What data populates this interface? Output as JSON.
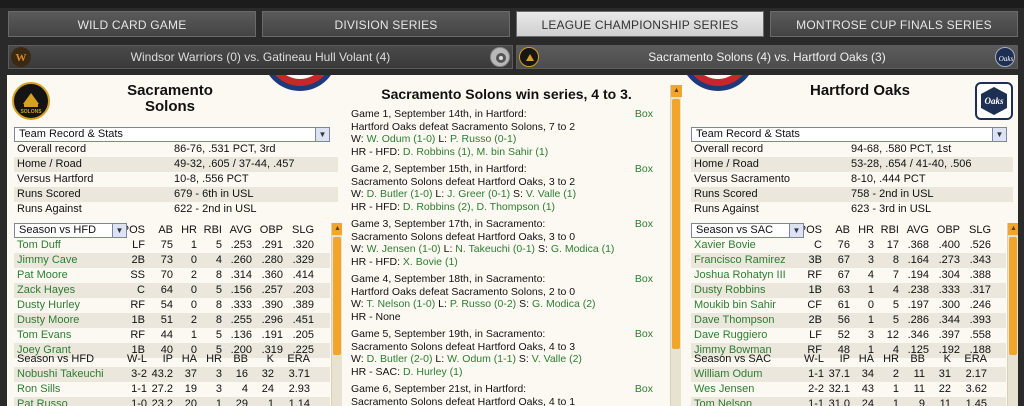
{
  "tabs": [
    {
      "label": "WILD CARD GAME",
      "active": false
    },
    {
      "label": "DIVISION SERIES",
      "active": false
    },
    {
      "label": "LEAGUE CHAMPIONSHIP SERIES",
      "active": true
    },
    {
      "label": "MONTROSE CUP FINALS SERIES",
      "active": false
    }
  ],
  "series": [
    {
      "label": "Windsor Warriors (0) vs. Gatineau Hull Volant  (4)",
      "active": false,
      "left_logo": "warriors-logo-icon",
      "right_logo": "volant-logo-icon"
    },
    {
      "label": "Sacramento Solons (4) vs. Hartford Oaks (3)",
      "active": true,
      "left_logo": "solons-logo-icon",
      "right_logo": "oaks-logo-icon"
    }
  ],
  "colors": {
    "accent_green": "#2e7d32",
    "scroll_orange": "#f1a52b",
    "active_tab": "#e0e0e0"
  },
  "left": {
    "team_name": "Sacramento Solons",
    "logo_text": "SOLONS",
    "dropdown": "Team Record & Stats",
    "stats": [
      {
        "label": "Overall record",
        "value": "86-76, .531 PCT, 3rd"
      },
      {
        "label": "Home / Road",
        "value": "49-32, .605 / 37-44, .457"
      },
      {
        "label": "Versus Hartford",
        "value": "10-8, .556 PCT"
      },
      {
        "label": "Runs Scored",
        "value": "679 - 6th  in USL"
      },
      {
        "label": "Runs Against",
        "value": "622 - 2nd  in USL"
      }
    ],
    "batting_dropdown": "Season vs HFD",
    "batting_headers": [
      "POS",
      "AB",
      "HR",
      "RBI",
      "AVG",
      "OBP",
      "SLG"
    ],
    "batters": [
      {
        "name": "Tom Duff",
        "pos": "LF",
        "ab": "75",
        "hr": "1",
        "rbi": "5",
        "avg": ".253",
        "obp": ".291",
        "slg": ".320"
      },
      {
        "name": "Jimmy Cave",
        "pos": "2B",
        "ab": "73",
        "hr": "0",
        "rbi": "4",
        "avg": ".260",
        "obp": ".280",
        "slg": ".329"
      },
      {
        "name": "Pat Moore",
        "pos": "SS",
        "ab": "70",
        "hr": "2",
        "rbi": "8",
        "avg": ".314",
        "obp": ".360",
        "slg": ".414"
      },
      {
        "name": "Zack Hayes",
        "pos": "C",
        "ab": "64",
        "hr": "0",
        "rbi": "5",
        "avg": ".156",
        "obp": ".257",
        "slg": ".203"
      },
      {
        "name": "Dusty Hurley",
        "pos": "RF",
        "ab": "54",
        "hr": "0",
        "rbi": "8",
        "avg": ".333",
        "obp": ".390",
        "slg": ".389"
      },
      {
        "name": "Dusty Moore",
        "pos": "1B",
        "ab": "51",
        "hr": "2",
        "rbi": "8",
        "avg": ".255",
        "obp": ".296",
        "slg": ".451"
      },
      {
        "name": "Tom Evans",
        "pos": "RF",
        "ab": "44",
        "hr": "1",
        "rbi": "5",
        "avg": ".136",
        "obp": ".191",
        "slg": ".205"
      },
      {
        "name": "Joey Grant",
        "pos": "1B",
        "ab": "40",
        "hr": "0",
        "rbi": "5",
        "avg": ".200",
        "obp": ".319",
        "slg": ".225"
      }
    ],
    "pitching_title": "Season vs HFD",
    "pitching_headers": [
      "W-L",
      "IP",
      "HA",
      "HR",
      "BB",
      "K",
      "ERA"
    ],
    "pitchers": [
      {
        "name": "Nobushi Takeuchi",
        "wl": "3-2",
        "ip": "43.2",
        "ha": "37",
        "hr": "3",
        "bb": "16",
        "k": "32",
        "era": "3.71"
      },
      {
        "name": "Ron Sills",
        "wl": "1-1",
        "ip": "27.2",
        "ha": "19",
        "hr": "3",
        "bb": "4",
        "k": "24",
        "era": "2.93"
      },
      {
        "name": "Pat Russo",
        "wl": "1-0",
        "ip": "23.2",
        "ha": "20",
        "hr": "1",
        "bb": "29",
        "k": "1",
        "era": "1.14"
      }
    ]
  },
  "center": {
    "title": "Sacramento Solons win series, 4 to 3.",
    "box_label": "Box",
    "games": [
      {
        "header": "Game 1, September 14th, in Hartford:",
        "result": "Hartford Oaks defeat Sacramento Solons, 7 to 2",
        "w_label": "W:",
        "w_text": "W. Odum (1-0)",
        "l_label": "L:",
        "l_text": "P. Russo (0-1)",
        "s_label": "",
        "s_text": "",
        "hr_label": "HR - HFD:",
        "hr_text": "D. Robbins (1), M. bin Sahir (1)"
      },
      {
        "header": "Game 2, September 15th, in Hartford:",
        "result": "Sacramento Solons defeat Hartford Oaks, 3 to 2",
        "w_label": "W:",
        "w_text": "D. Butler (1-0)",
        "l_label": "L:",
        "l_text": "J. Greer (0-1)",
        "s_label": "S:",
        "s_text": "V. Valle (1)",
        "hr_label": "HR - HFD:",
        "hr_text": "D. Robbins (2), D. Thompson (1)"
      },
      {
        "header": "Game 3, September 17th, in Sacramento:",
        "result": "Sacramento Solons defeat Hartford Oaks, 3 to 0",
        "w_label": "W:",
        "w_text": "W. Jensen (1-0)",
        "l_label": "L:",
        "l_text": "N. Takeuchi (0-1)",
        "s_label": "S:",
        "s_text": "G. Modica (1)",
        "hr_label": "HR - HFD:",
        "hr_text": "X. Bovie (1)"
      },
      {
        "header": "Game 4, September 18th, in Sacramento:",
        "result": "Hartford Oaks defeat Sacramento Solons, 2 to 0",
        "w_label": "W:",
        "w_text": "T. Nelson (1-0)",
        "l_label": "L:",
        "l_text": "P. Russo (0-2)",
        "s_label": "S:",
        "s_text": "G. Modica (2)",
        "hr_label": "HR - None",
        "hr_text": ""
      },
      {
        "header": "Game 5, September 19th, in Sacramento:",
        "result": "Sacramento Solons defeat Hartford Oaks, 4 to 3",
        "w_label": "W:",
        "w_text": "D. Butler (2-0)",
        "l_label": "L:",
        "l_text": "W. Odum (1-1)",
        "s_label": "S:",
        "s_text": "V. Valle (2)",
        "hr_label": "HR - SAC:",
        "hr_text": "D. Hurley (1)"
      },
      {
        "header": "Game 6, September 21st, in Hartford:",
        "result": "Sacramento Solons defeat Hartford Oaks, 4 to 1",
        "w_label": "",
        "w_text": "",
        "l_label": "",
        "l_text": "",
        "s_label": "",
        "s_text": "",
        "hr_label": "",
        "hr_text": ""
      }
    ]
  },
  "right": {
    "team_name": "Hartford Oaks",
    "logo_text": "Oaks",
    "dropdown": "Team Record & Stats",
    "stats": [
      {
        "label": "Overall record",
        "value": "94-68, .580 PCT, 1st"
      },
      {
        "label": "Home / Road",
        "value": "53-28, .654 / 41-40, .506"
      },
      {
        "label": "Versus Sacramento",
        "value": "8-10, .444 PCT"
      },
      {
        "label": "Runs Scored",
        "value": "758 - 2nd  in USL"
      },
      {
        "label": "Runs Against",
        "value": "623 - 3rd  in USL"
      }
    ],
    "batting_dropdown": "Season vs SAC",
    "batting_headers": [
      "POS",
      "AB",
      "HR",
      "RBI",
      "AVG",
      "OBP",
      "SLG"
    ],
    "batters": [
      {
        "name": "Xavier Bovie",
        "pos": "C",
        "ab": "76",
        "hr": "3",
        "rbi": "17",
        "avg": ".368",
        "obp": ".400",
        "slg": ".526"
      },
      {
        "name": "Francisco Ramirez",
        "pos": "3B",
        "ab": "67",
        "hr": "3",
        "rbi": "8",
        "avg": ".164",
        "obp": ".273",
        "slg": ".343"
      },
      {
        "name": "Joshua Rohatyn III",
        "pos": "RF",
        "ab": "67",
        "hr": "4",
        "rbi": "7",
        "avg": ".194",
        "obp": ".304",
        "slg": ".388"
      },
      {
        "name": "Dusty Robbins",
        "pos": "1B",
        "ab": "63",
        "hr": "1",
        "rbi": "4",
        "avg": ".238",
        "obp": ".333",
        "slg": ".317"
      },
      {
        "name": "Moukib bin Sahir",
        "pos": "CF",
        "ab": "61",
        "hr": "0",
        "rbi": "5",
        "avg": ".197",
        "obp": ".300",
        "slg": ".246"
      },
      {
        "name": "Dave Thompson",
        "pos": "2B",
        "ab": "56",
        "hr": "1",
        "rbi": "5",
        "avg": ".286",
        "obp": ".344",
        "slg": ".393"
      },
      {
        "name": "Dave Ruggiero",
        "pos": "LF",
        "ab": "52",
        "hr": "3",
        "rbi": "12",
        "avg": ".346",
        "obp": ".397",
        "slg": ".558"
      },
      {
        "name": "Jimmy Bowman",
        "pos": "RF",
        "ab": "48",
        "hr": "1",
        "rbi": "4",
        "avg": ".125",
        "obp": ".192",
        "slg": ".188"
      }
    ],
    "pitching_title": "Season vs SAC",
    "pitching_headers": [
      "W-L",
      "IP",
      "HA",
      "HR",
      "BB",
      "K",
      "ERA"
    ],
    "pitchers": [
      {
        "name": "William Odum",
        "wl": "1-1",
        "ip": "37.1",
        "ha": "34",
        "hr": "2",
        "bb": "11",
        "k": "31",
        "era": "2.17"
      },
      {
        "name": "Wes Jensen",
        "wl": "2-2",
        "ip": "32.1",
        "ha": "43",
        "hr": "1",
        "bb": "11",
        "k": "22",
        "era": "3.62"
      },
      {
        "name": "Tom Nelson",
        "wl": "1-1",
        "ip": "31.0",
        "ha": "24",
        "hr": "1",
        "bb": "9",
        "k": "11",
        "era": "1.45"
      }
    ]
  }
}
